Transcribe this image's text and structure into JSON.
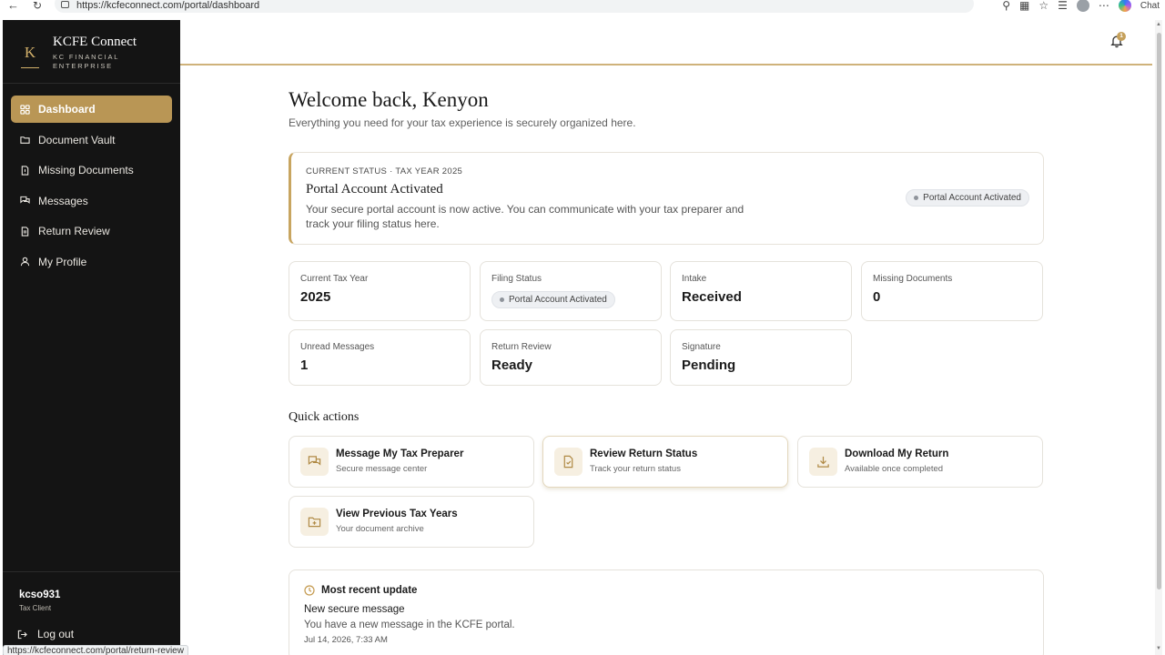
{
  "browser": {
    "url": "https://kcfeconnect.com/portal/dashboard",
    "copilot_label": "Chat",
    "hover_url": "https://kcfeconnect.com/portal/return-review"
  },
  "sidebar": {
    "brand_mark": "K",
    "brand_title": "KCFE Connect",
    "brand_subtitle": "KC FINANCIAL ENTERPRISE",
    "items": [
      {
        "label": "Dashboard",
        "icon": "grid-icon",
        "active": true
      },
      {
        "label": "Document Vault",
        "icon": "folder-icon",
        "active": false
      },
      {
        "label": "Missing Documents",
        "icon": "file-alert-icon",
        "active": false
      },
      {
        "label": "Messages",
        "icon": "chat-icon",
        "active": false
      },
      {
        "label": "Return Review",
        "icon": "file-text-icon",
        "active": false
      },
      {
        "label": "My Profile",
        "icon": "user-icon",
        "active": false
      }
    ],
    "user": {
      "name": "kcso931",
      "role": "Tax Client"
    },
    "logout_label": "Log out"
  },
  "header": {
    "notification_count": "1"
  },
  "main": {
    "welcome": "Welcome back, Kenyon",
    "welcome_sub": "Everything you need for your tax experience is securely organized here.",
    "status": {
      "eyebrow": "CURRENT STATUS · TAX YEAR 2025",
      "title": "Portal Account Activated",
      "description": "Your secure portal account is now active. You can communicate with your tax preparer and track your filing status here.",
      "pill": "Portal Account Activated"
    },
    "stats": [
      {
        "label": "Current Tax Year",
        "value": "2025"
      },
      {
        "label": "Filing Status",
        "pill": "Portal Account Activated"
      },
      {
        "label": "Intake",
        "value": "Received"
      },
      {
        "label": "Missing Documents",
        "value": "0"
      },
      {
        "label": "Unread Messages",
        "value": "1"
      },
      {
        "label": "Return Review",
        "value": "Ready"
      },
      {
        "label": "Signature",
        "value": "Pending"
      }
    ],
    "quick_actions_heading": "Quick actions",
    "quick_actions": [
      {
        "title": "Message My Tax Preparer",
        "subtitle": "Secure message center",
        "icon": "chat-icon"
      },
      {
        "title": "Review Return Status",
        "subtitle": "Track your return status",
        "icon": "document-icon"
      },
      {
        "title": "Download My Return",
        "subtitle": "Available once completed",
        "icon": "download-icon"
      },
      {
        "title": "View Previous Tax Years",
        "subtitle": "Your document archive",
        "icon": "folder-icon"
      }
    ],
    "recent": {
      "heading": "Most recent update",
      "title": "New secure message",
      "description": "You have a new message in the KCFE portal.",
      "time": "Jul 14, 2026, 7:33 AM"
    }
  },
  "colors": {
    "accent": "#b99655",
    "sidebar_bg": "#141414",
    "gold_line": "#cfb27a"
  }
}
